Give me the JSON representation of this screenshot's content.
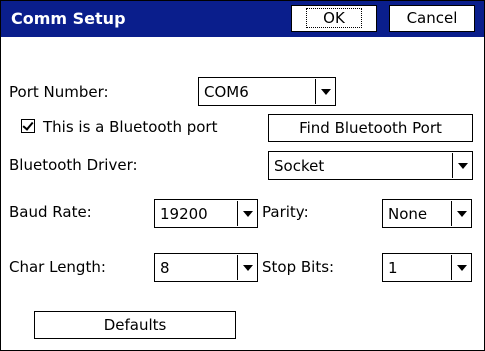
{
  "window": {
    "title": "Comm Setup",
    "ok_label": "OK",
    "cancel_label": "Cancel"
  },
  "form": {
    "port_number_label": "Port Number:",
    "port_number_value": "COM6",
    "bluetooth_checkbox_label": "This is a Bluetooth port",
    "bluetooth_checked": true,
    "find_bluetooth_label": "Find Bluetooth Port",
    "bluetooth_driver_label": "Bluetooth Driver:",
    "bluetooth_driver_value": "Socket",
    "baud_rate_label": "Baud Rate:",
    "baud_rate_value": "19200",
    "parity_label": "Parity:",
    "parity_value": "None",
    "char_length_label": "Char Length:",
    "char_length_value": "8",
    "stop_bits_label": "Stop Bits:",
    "stop_bits_value": "1",
    "defaults_label": "Defaults"
  },
  "colors": {
    "titlebar": "#0a1e8c"
  }
}
